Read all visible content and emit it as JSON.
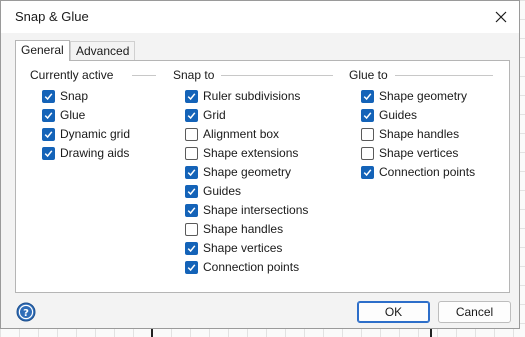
{
  "dialog": {
    "title": "Snap & Glue",
    "tabs": [
      {
        "label": "General",
        "active": true
      },
      {
        "label": "Advanced",
        "active": false
      }
    ],
    "buttons": {
      "ok": "OK",
      "cancel": "Cancel"
    },
    "help_icon": "question-icon",
    "accent_color": "#1463b8"
  },
  "groups": {
    "currently_active": {
      "title": "Currently active",
      "items": [
        {
          "label": "Snap",
          "checked": true
        },
        {
          "label": "Glue",
          "checked": true
        },
        {
          "label": "Dynamic grid",
          "checked": true
        },
        {
          "label": "Drawing aids",
          "checked": true
        }
      ]
    },
    "snap_to": {
      "title": "Snap to",
      "items": [
        {
          "label": "Ruler subdivisions",
          "checked": true
        },
        {
          "label": "Grid",
          "checked": true
        },
        {
          "label": "Alignment box",
          "checked": false
        },
        {
          "label": "Shape extensions",
          "checked": false
        },
        {
          "label": "Shape geometry",
          "checked": true
        },
        {
          "label": "Guides",
          "checked": true
        },
        {
          "label": "Shape intersections",
          "checked": true
        },
        {
          "label": "Shape handles",
          "checked": false
        },
        {
          "label": "Shape vertices",
          "checked": true
        },
        {
          "label": "Connection points",
          "checked": true
        }
      ]
    },
    "glue_to": {
      "title": "Glue to",
      "items": [
        {
          "label": "Shape geometry",
          "checked": true
        },
        {
          "label": "Guides",
          "checked": true
        },
        {
          "label": "Shape handles",
          "checked": false
        },
        {
          "label": "Shape vertices",
          "checked": false
        },
        {
          "label": "Connection points",
          "checked": true
        }
      ]
    }
  }
}
